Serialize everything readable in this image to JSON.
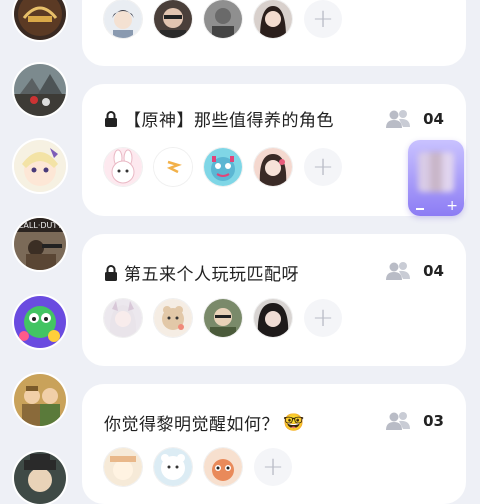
{
  "rooms": [
    {
      "title": "",
      "count": ""
    },
    {
      "title": "【原神】那些值得养的角色",
      "count": "04"
    },
    {
      "title": "第五来个人玩玩匹配呀",
      "count": "04"
    },
    {
      "title": "你觉得黎明觉醒如何？",
      "count": "03",
      "emoji": "🤓"
    }
  ],
  "add_symbol": "+",
  "colors": {
    "background": "#eef0f6",
    "card": "#ffffff",
    "widget": "#9d8ff7"
  }
}
